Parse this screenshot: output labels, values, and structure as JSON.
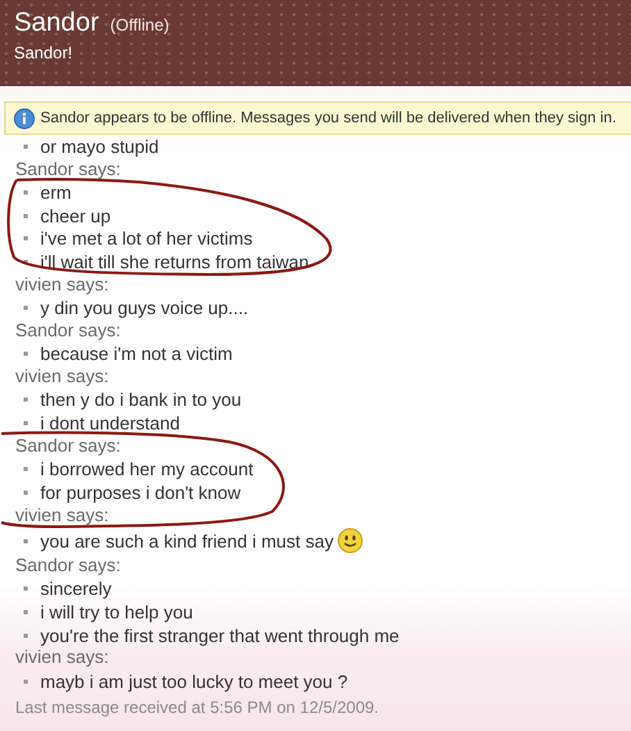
{
  "header": {
    "name": "Sandor",
    "status": "(Offline)",
    "personal_message": "Sandor!"
  },
  "info_bar": {
    "text": "Sandor appears to be offline. Messages you send will be delivered when they sign in."
  },
  "messages": [
    {
      "kind": "line",
      "text": "or mayo stupid",
      "emoticon": false
    },
    {
      "kind": "sender",
      "text": "Sandor says:"
    },
    {
      "kind": "line",
      "text": "erm",
      "emoticon": false
    },
    {
      "kind": "line",
      "text": "cheer up",
      "emoticon": false
    },
    {
      "kind": "line",
      "text": "i've met a lot of her victims",
      "emoticon": false
    },
    {
      "kind": "line",
      "text": "i'll wait till she returns from taiwan",
      "emoticon": false
    },
    {
      "kind": "sender",
      "text": "vivien says:"
    },
    {
      "kind": "line",
      "text": "y din you guys voice up....",
      "emoticon": false
    },
    {
      "kind": "sender",
      "text": "Sandor says:"
    },
    {
      "kind": "line",
      "text": "because i'm not a victim",
      "emoticon": false
    },
    {
      "kind": "sender",
      "text": "vivien says:"
    },
    {
      "kind": "line",
      "text": "then y do i bank in to you",
      "emoticon": false
    },
    {
      "kind": "line",
      "text": "i dont understand",
      "emoticon": false
    },
    {
      "kind": "sender",
      "text": "Sandor says:"
    },
    {
      "kind": "line",
      "text": "i borrowed her my account",
      "emoticon": false
    },
    {
      "kind": "line",
      "text": "for purposes i don't know",
      "emoticon": false
    },
    {
      "kind": "sender",
      "text": "vivien says:"
    },
    {
      "kind": "line",
      "text": "you are such a kind friend i must say",
      "emoticon": true
    },
    {
      "kind": "sender",
      "text": "Sandor says:"
    },
    {
      "kind": "line",
      "text": "sincerely",
      "emoticon": false
    },
    {
      "kind": "line",
      "text": "i will try to help you",
      "emoticon": false
    },
    {
      "kind": "line",
      "text": "you're the first stranger that went through me",
      "emoticon": false
    },
    {
      "kind": "sender",
      "text": "vivien says:"
    },
    {
      "kind": "line",
      "text": "mayb i am just too lucky to meet you ?",
      "emoticon": false
    }
  ],
  "footer": {
    "text": "Last message received at 5:56 PM on 12/5/2009."
  }
}
